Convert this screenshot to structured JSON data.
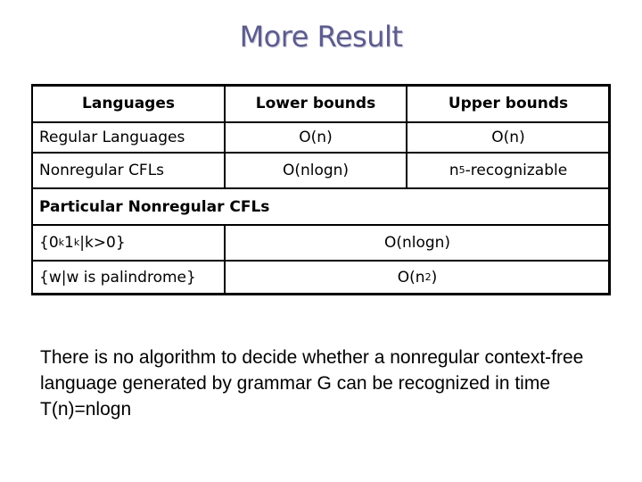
{
  "slide": {
    "title": "More Result",
    "table": {
      "headers": [
        "Languages",
        "Lower bounds",
        "Upper bounds"
      ],
      "rows": [
        {
          "language": "Regular Languages",
          "lower": "O(n)",
          "upper": "O(n)"
        },
        {
          "language": "Nonregular CFLs",
          "lower": "O(nlogn)",
          "upper_base": "n",
          "upper_sup": "5",
          "upper_rest": "-recognizable"
        }
      ],
      "section_header": "Particular Nonregular CFLs",
      "particular_rows": [
        {
          "language_parts": [
            "{0",
            "k",
            "1",
            "k",
            "|k>0}"
          ],
          "bound": "O(nlogn)"
        },
        {
          "language": "{w|w is palindrome}",
          "bound_base": "O(n",
          "bound_sup": "2",
          "bound_rest": ")"
        }
      ]
    },
    "note": "There is no algorithm to decide whether a nonregular context-free language generated by grammar G can be recognized in time T(n)=nlogn"
  }
}
